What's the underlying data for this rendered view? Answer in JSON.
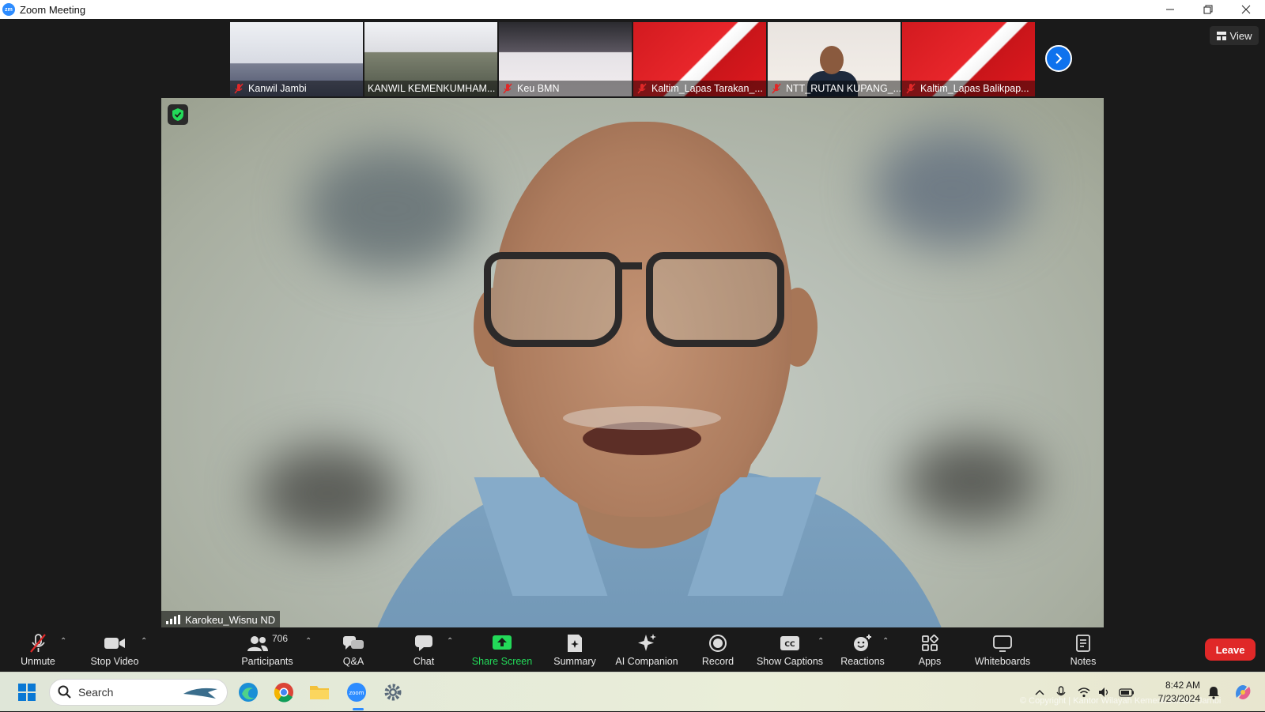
{
  "window": {
    "title": "Zoom Meeting",
    "app_icon_text": "zm",
    "controls": [
      "minimize",
      "restore",
      "close"
    ]
  },
  "gallery": {
    "thumbnails": [
      {
        "name": "Kanwil Jambi",
        "muted": true
      },
      {
        "name": "KANWIL KEMENKUMHAM...",
        "muted": false
      },
      {
        "name": "Keu BMN",
        "muted": true
      },
      {
        "name": "Kaltim_Lapas Tarakan_...",
        "muted": true
      },
      {
        "name": "NTT_RUTAN KUPANG_...",
        "muted": true
      },
      {
        "name": "Kaltim_Lapas Balikpap...",
        "muted": true
      }
    ],
    "next_icon": "chevron-right-icon"
  },
  "view_button": {
    "label": "View"
  },
  "active_speaker": {
    "name": "Karokeu_Wisnu ND"
  },
  "toolbar": {
    "unmute": "Unmute",
    "stop_video": "Stop Video",
    "participants": "Participants",
    "participants_count": "706",
    "qa": "Q&A",
    "chat": "Chat",
    "share_screen": "Share Screen",
    "summary": "Summary",
    "ai_companion": "AI Companion",
    "record": "Record",
    "show_captions": "Show Captions",
    "reactions": "Reactions",
    "apps": "Apps",
    "whiteboards": "Whiteboards",
    "notes": "Notes",
    "leave": "Leave",
    "accent_green": "#23d959",
    "leave_color": "#e02828"
  },
  "taskbar": {
    "search_placeholder": "Search",
    "time": "8:42 AM",
    "date": "7/23/2024",
    "watermark": "© Copyright | Kantor Wilayah Kemenkumham Jambi"
  }
}
